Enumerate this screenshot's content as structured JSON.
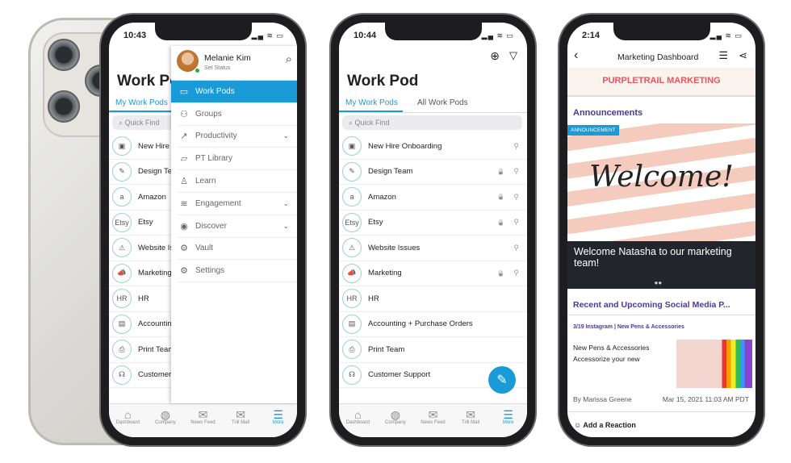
{
  "accent": "#1a9ad6",
  "tabbar": [
    {
      "icon": "home-icon",
      "glyph": "⌂",
      "label": "Dashboard"
    },
    {
      "icon": "globe-icon",
      "glyph": "◍",
      "label": "Company"
    },
    {
      "icon": "news-feed-icon",
      "glyph": "✉",
      "label": "News Feed"
    },
    {
      "icon": "mail-icon",
      "glyph": "✉",
      "label": "Trill Mail"
    },
    {
      "icon": "menu-icon",
      "glyph": "☰",
      "label": "More"
    }
  ],
  "pods": [
    {
      "name": "New Hire Onboarding",
      "icon": "onboarding-icon",
      "glyph": "▣",
      "lock": false,
      "pin": true
    },
    {
      "name": "Design Team",
      "icon": "design-icon",
      "glyph": "✎",
      "lock": true,
      "pin": true
    },
    {
      "name": "Amazon",
      "icon": "amazon-logo-icon",
      "glyph": "a",
      "lock": true,
      "pin": true
    },
    {
      "name": "Etsy",
      "icon": "etsy-logo-icon",
      "glyph": "Etsy",
      "lock": true,
      "pin": true
    },
    {
      "name": "Website Issues",
      "icon": "warning-icon",
      "glyph": "⚠",
      "lock": false,
      "pin": true
    },
    {
      "name": "Marketing",
      "icon": "megaphone-icon",
      "glyph": "📣",
      "lock": true,
      "pin": true
    },
    {
      "name": "HR",
      "icon": "hr-icon",
      "glyph": "HR",
      "lock": false,
      "pin": false
    },
    {
      "name": "Accounting + Purchase Orders",
      "icon": "clipboard-icon",
      "glyph": "▤",
      "lock": false,
      "pin": false
    },
    {
      "name": "Print Team",
      "icon": "printer-icon",
      "glyph": "⎙",
      "lock": false,
      "pin": false
    },
    {
      "name": "Customer Support",
      "icon": "headset-icon",
      "glyph": "☊",
      "lock": false,
      "pin": false
    }
  ],
  "phone1": {
    "time": "10:43",
    "title": "Work Pods",
    "tab_my": "My Work Pods",
    "search_placeholder": "Quick Find",
    "drawer": {
      "user": "Melanie Kim",
      "status": "Set Status",
      "items": [
        {
          "label": "Work Pods",
          "icon": "briefcase-icon",
          "glyph": "▭",
          "active": true
        },
        {
          "label": "Groups",
          "icon": "groups-icon",
          "glyph": "⚇"
        },
        {
          "label": "Productivity",
          "icon": "chart-icon",
          "glyph": "↗",
          "chevron": true
        },
        {
          "label": "PT Library",
          "icon": "folder-icon",
          "glyph": "▱"
        },
        {
          "label": "Learn",
          "icon": "learn-icon",
          "glyph": "♙"
        },
        {
          "label": "Engagement",
          "icon": "handshake-icon",
          "glyph": "≋",
          "chevron": true
        },
        {
          "label": "Discover",
          "icon": "eye-icon",
          "glyph": "◉",
          "chevron": true
        },
        {
          "label": "Vault",
          "icon": "vault-icon",
          "glyph": "⚙"
        },
        {
          "label": "Settings",
          "icon": "gear-icon",
          "glyph": "⚙"
        }
      ]
    }
  },
  "phone2": {
    "time": "10:44",
    "title": "Work Pod",
    "tab_my": "My Work Pods",
    "tab_all": "All Work Pods",
    "search_placeholder": "Quick Find"
  },
  "phone3": {
    "time": "2:14",
    "title": "Marketing Dashboard",
    "banner": "PURPLETRAIL MARKETING",
    "announcements": "Announcements",
    "badge": "ANNOUNCEMENT",
    "welcome": "Welcome!",
    "caption": "Welcome Natasha to our  marketing team!",
    "section": "Recent and Upcoming Social Media P...",
    "post_tag": "3/19 Instagram | New Pens & Accessories",
    "post_line1": "New Pens & Accessories",
    "post_line2": "Accessorize your new",
    "author": "By Marissa Greene",
    "date": "Mar 15, 2021 11:03 AM PDT",
    "reaction": "Add a Reaction",
    "purple": "#4a3a96"
  }
}
